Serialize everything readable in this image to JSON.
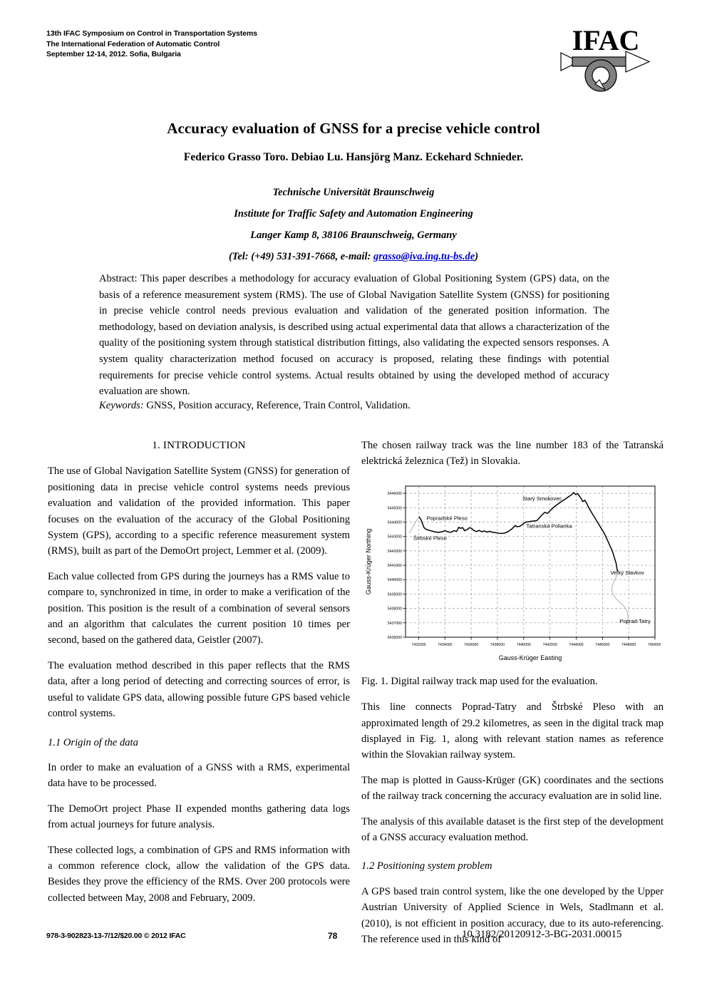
{
  "header": {
    "lines": [
      "13th IFAC Symposium on Control in Transportation Systems",
      "The International Federation of Automatic Control",
      "September 12-14, 2012. Sofia, Bulgaria"
    ],
    "logo_text": "IFAC"
  },
  "title": "Accuracy evaluation of GNSS for a precise vehicle control",
  "authors": "Federico Grasso Toro. Debiao Lu. Hansjörg Manz. Eckehard Schnieder.",
  "affiliation": {
    "university": "Technische Universität Braunschweig",
    "institute": "Institute for Traffic Safety and Automation Engineering",
    "address": "Langer Kamp 8, 38106 Braunschweig, Germany",
    "contact_prefix": "(Tel: (+49) 531-391-7668, e-mail: ",
    "email": "grasso@iva.ing.tu-bs.de",
    "contact_suffix": ")"
  },
  "abstract": {
    "label": "Abstract:",
    "text": " This paper describes a methodology for accuracy evaluation of Global Positioning System (GPS) data, on the basis of a reference measurement system (RMS). The use of Global Navigation Satellite System (GNSS) for positioning in precise vehicle control needs previous evaluation and validation of the generated position information. The methodology, based on deviation analysis, is described using actual experimental data that allows a characterization of the quality of the positioning system through statistical distribution fittings, also validating the expected sensors responses. A system quality characterization method focused on accuracy is proposed, relating these findings with potential requirements for precise vehicle control systems. Actual results obtained by using the developed method of accuracy evaluation are shown."
  },
  "keywords": {
    "label": "Keywords:",
    "text": " GNSS, Position accuracy, Reference, Train Control, Validation."
  },
  "left_column": {
    "section_heading": "1. INTRODUCTION",
    "paragraphs": [
      "The use of Global Navigation Satellite System (GNSS) for generation of positioning data in precise vehicle control systems needs previous evaluation and validation of the provided information. This paper focuses on the evaluation of the accuracy of the Global Positioning System (GPS), according to a specific reference measurement system (RMS), built as part of the DemoOrt project, Lemmer et al. (2009).",
      "Each value collected from GPS during the journeys has a RMS value to compare to, synchronized in time, in order to make a verification of the position. This position is the result of a combination of several sensors and an algorithm that calculates the current position 10 times per second, based on the gathered data, Geistler (2007).",
      "The evaluation method described in this paper reflects that the RMS data, after a long period of detecting and correcting sources of error, is useful to validate GPS data, allowing possible future GPS based vehicle control systems."
    ],
    "subsection_heading": "1.1 Origin of the data",
    "paragraphs_after": [
      "In order to make an evaluation of a GNSS with a RMS, experimental data have to be processed.",
      "The DemoOrt project Phase II expended months gathering data logs from actual journeys for future analysis.",
      "These collected logs, a combination of GPS and RMS information with a common reference clock, allow the validation of the GPS data. Besides they prove the efficiency of the RMS. Over 200 protocols were collected between May, 2008 and February, 2009."
    ]
  },
  "right_column": {
    "intro_paragraph": "The chosen railway track was the line number 183 of the Tatranská elektrická železnica (Tež) in Slovakia.",
    "figure_caption": "Fig. 1. Digital railway track map used for the evaluation.",
    "paragraphs": [
      "This line connects Poprad-Tatry and Štrbské Pleso with an approximated length of 29.2 kilometres, as seen in the digital track map displayed in Fig. 1, along with relevant station names as reference within the Slovakian railway system.",
      "The map is plotted in Gauss-Krüger (GK) coordinates and the sections of the railway track concerning the accuracy evaluation are in solid line.",
      "The analysis of this available dataset is the first step of the development of a GNSS accuracy evaluation method."
    ],
    "subsection_heading": "1.2 Positioning system problem",
    "paragraphs_after": [
      "A GPS based train control system, like the one developed by the Upper Austrian University of Applied Science in Wels, Stadlmann et al. (2010), is not efficient in position accuracy, due to its auto-referencing. The reference used in this kind of"
    ]
  },
  "chart_data": {
    "type": "line",
    "title": "",
    "xlabel": "Gauss-Krüger Easting",
    "ylabel": "Gauss-Krüger Northing",
    "xlim": [
      7431000,
      7450000
    ],
    "ylim": [
      5436000,
      5446500
    ],
    "xticks": [
      7432000,
      7434000,
      7436000,
      7438000,
      7440000,
      7442000,
      7444000,
      7446000,
      7448000,
      7450000
    ],
    "xtick_labels": [
      "7432000",
      "7434000",
      "7436000",
      "7438000",
      "7440000",
      "7442000",
      "7444000",
      "7446000",
      "7448000",
      "7450000"
    ],
    "yticks": [
      5436000,
      5437000,
      5438000,
      5439000,
      5440000,
      5441000,
      5442000,
      5443000,
      5444000,
      5445000,
      5446000
    ],
    "ytick_labels": [
      "5436000",
      "5437000",
      "5438000",
      "5439000",
      "5440000",
      "5441000",
      "5442000",
      "5443000",
      "5444000",
      "5445000",
      "5446000"
    ],
    "grid": true,
    "legend": "none",
    "annotations": [
      {
        "label": "Popradské Pleso",
        "x": 7432600,
        "y": 5444150
      },
      {
        "label": "Štrbské Pleso",
        "x": 7431600,
        "y": 5442750
      },
      {
        "label": "Starý Smokovec",
        "x": 7439900,
        "y": 5445500
      },
      {
        "label": "Tatranská Polianka",
        "x": 7440200,
        "y": 5443600
      },
      {
        "label": "Veľký Slavkov",
        "x": 7446600,
        "y": 5440350
      },
      {
        "label": "Poprad-Tatry",
        "x": 7447300,
        "y": 5437000
      }
    ],
    "series": [
      {
        "name": "track-dashed-start",
        "style": "light",
        "points": [
          [
            7431300,
            5443250
          ],
          [
            7431500,
            5443550
          ],
          [
            7431700,
            5443900
          ],
          [
            7431900,
            5444200
          ],
          [
            7432050,
            5444350
          ]
        ]
      },
      {
        "name": "track-solid",
        "style": "solid",
        "points": [
          [
            7432050,
            5444350
          ],
          [
            7432200,
            5444120
          ],
          [
            7432320,
            5443820
          ],
          [
            7432420,
            5443600
          ],
          [
            7432600,
            5443480
          ],
          [
            7432900,
            5443400
          ],
          [
            7433200,
            5443330
          ],
          [
            7433500,
            5443280
          ],
          [
            7433800,
            5443330
          ],
          [
            7434000,
            5443400
          ],
          [
            7434200,
            5443330
          ],
          [
            7434450,
            5443290
          ],
          [
            7434700,
            5443400
          ],
          [
            7434900,
            5443350
          ],
          [
            7435050,
            5443640
          ],
          [
            7435200,
            5443560
          ],
          [
            7435350,
            5443620
          ],
          [
            7435500,
            5443400
          ],
          [
            7435700,
            5443480
          ],
          [
            7435900,
            5443620
          ],
          [
            7436050,
            5443540
          ],
          [
            7436200,
            5443420
          ],
          [
            7436400,
            5443340
          ],
          [
            7436600,
            5443420
          ],
          [
            7436800,
            5443330
          ],
          [
            7437000,
            5443380
          ],
          [
            7437200,
            5443300
          ],
          [
            7437400,
            5443360
          ],
          [
            7437600,
            5443300
          ],
          [
            7437900,
            5443260
          ],
          [
            7438200,
            5443210
          ],
          [
            7438500,
            5443220
          ],
          [
            7438800,
            5443330
          ],
          [
            7439100,
            5443520
          ],
          [
            7439350,
            5443760
          ],
          [
            7439500,
            5443680
          ],
          [
            7439700,
            5443700
          ],
          [
            7439900,
            5443830
          ],
          [
            7440150,
            5444000
          ],
          [
            7440350,
            5444020
          ],
          [
            7440600,
            5444060
          ],
          [
            7441000,
            5444100
          ],
          [
            7441200,
            5444300
          ],
          [
            7441400,
            5444500
          ],
          [
            7441600,
            5444680
          ],
          [
            7441800,
            5444600
          ],
          [
            7442000,
            5444780
          ],
          [
            7442250,
            5445000
          ],
          [
            7442500,
            5445180
          ],
          [
            7442800,
            5445380
          ],
          [
            7443100,
            5445560
          ],
          [
            7443400,
            5445750
          ],
          [
            7443650,
            5445900
          ],
          [
            7443800,
            5446050
          ],
          [
            7443950,
            5445920
          ],
          [
            7444100,
            5445980
          ],
          [
            7444250,
            5445800
          ],
          [
            7444400,
            5445600
          ],
          [
            7444500,
            5445420
          ],
          [
            7444650,
            5445520
          ],
          [
            7444800,
            5445300
          ],
          [
            7444950,
            5445000
          ],
          [
            7445150,
            5444700
          ],
          [
            7445350,
            5444400
          ],
          [
            7445550,
            5444100
          ],
          [
            7445750,
            5443800
          ],
          [
            7445950,
            5443500
          ],
          [
            7446150,
            5443200
          ],
          [
            7446300,
            5442900
          ],
          [
            7446450,
            5442600
          ],
          [
            7446600,
            5442300
          ],
          [
            7446750,
            5442000
          ],
          [
            7446850,
            5441700
          ],
          [
            7446950,
            5441400
          ],
          [
            7447050,
            5441100
          ],
          [
            7447100,
            5440800
          ],
          [
            7447150,
            5440560
          ]
        ]
      },
      {
        "name": "track-dashed-end",
        "style": "light",
        "points": [
          [
            7447150,
            5440560
          ],
          [
            7447100,
            5440300
          ],
          [
            7446950,
            5440000
          ],
          [
            7446800,
            5439700
          ],
          [
            7446700,
            5439400
          ],
          [
            7446750,
            5439100
          ],
          [
            7446900,
            5438850
          ],
          [
            7447100,
            5438600
          ],
          [
            7447350,
            5438400
          ],
          [
            7447600,
            5438200
          ],
          [
            7447800,
            5437950
          ],
          [
            7447900,
            5437700
          ],
          [
            7447950,
            5437400
          ],
          [
            7447900,
            5437150
          ],
          [
            7447800,
            5436950
          ]
        ]
      }
    ]
  },
  "footer": {
    "isbn": "978-3-902823-13-7/12/$20.00 © 2012 IFAC",
    "page_number": "78",
    "doi": "10.3182/20120912-3-BG-2031.00015"
  }
}
